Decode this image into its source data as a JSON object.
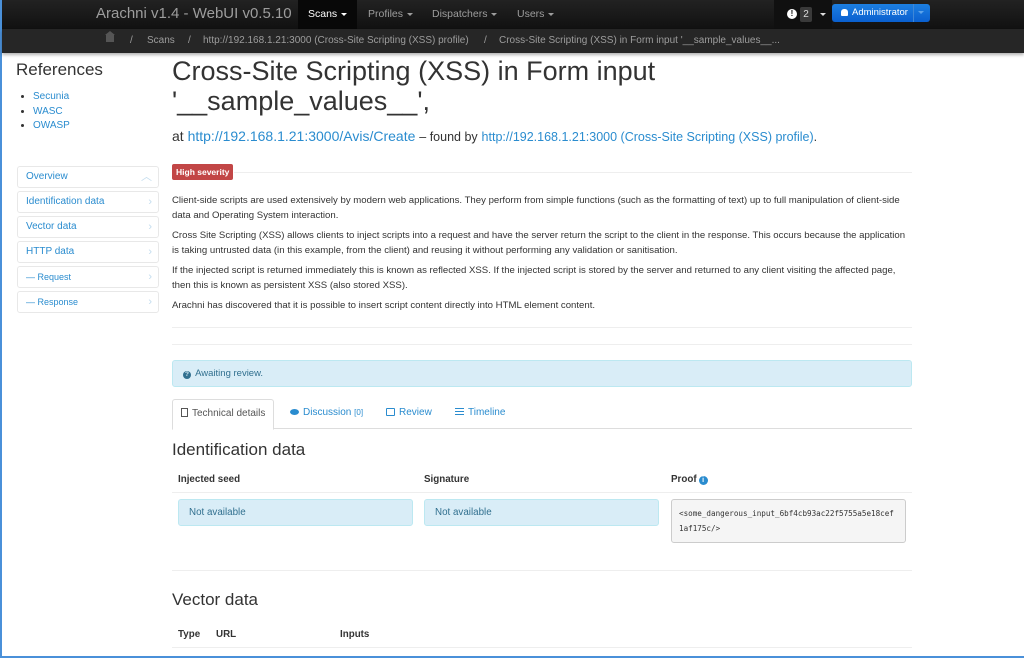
{
  "navbar": {
    "brand": "Arachni v1.4 - WebUI v0.5.10",
    "items": [
      {
        "label": "Scans",
        "active": true
      },
      {
        "label": "Profiles",
        "active": false
      },
      {
        "label": "Dispatchers",
        "active": false
      },
      {
        "label": "Users",
        "active": false
      }
    ],
    "notifications": {
      "icon": "exclamation-circle-icon",
      "count": "2"
    },
    "user": {
      "icon": "user-icon",
      "label": "Administrator"
    }
  },
  "breadcrumb": {
    "home_icon": "home-icon",
    "items": [
      "Scans",
      "http://192.168.1.21:3000 (Cross-Site Scripting (XSS) profile)",
      "Cross-Site Scripting (XSS) in Form input '__sample_values__..."
    ],
    "separator": "/"
  },
  "sidebar": {
    "references_title": "References",
    "references": [
      "Secunia",
      "WASC",
      "OWASP"
    ],
    "nav": [
      {
        "label": "Overview",
        "icon": "chevron-up-icon"
      },
      {
        "label": "Identification data",
        "icon": "chevron-right-icon"
      },
      {
        "label": "Vector data",
        "icon": "chevron-right-icon"
      },
      {
        "label": "HTTP data",
        "icon": "chevron-right-icon"
      },
      {
        "label": "— Request",
        "icon": "chevron-right-icon"
      },
      {
        "label": "— Response",
        "icon": "chevron-right-icon"
      }
    ]
  },
  "issue": {
    "title_line1": "Cross-Site Scripting (XSS) in Form input",
    "title_line2": "'__sample_values__',",
    "at_label": "at",
    "url": "http://192.168.1.21:3000/Avis/Create",
    "found_by_label": "– found by",
    "profile": "http://192.168.1.21:3000 (Cross-Site Scripting (XSS) profile)",
    "period": ".",
    "severity": "High severity",
    "severity_color": "#c24646",
    "description": [
      "Client-side scripts are used extensively by modern web applications. They perform from simple functions (such as the formatting of text) up to full manipulation of client-side data and Operating System interaction.",
      "Cross Site Scripting (XSS) allows clients to inject scripts into a request and have the server return the script to the client in the response. This occurs because the application is taking untrusted data (in this example, from the client) and reusing it without performing any validation or sanitisation.",
      "If the injected script is returned immediately this is known as reflected XSS. If the injected script is stored by the server and returned to any client visiting the affected page, then this is known as persistent XSS (also stored XSS).",
      "Arachni has discovered that it is possible to insert script content directly into HTML element content."
    ],
    "review_status": "Awaiting review."
  },
  "tabs": [
    {
      "label": "Technical details",
      "icon": "file-icon",
      "active": true
    },
    {
      "label": "Discussion",
      "count": "[0]",
      "icon": "comments-icon",
      "active": false
    },
    {
      "label": "Review",
      "icon": "edit-icon",
      "active": false
    },
    {
      "label": "Timeline",
      "icon": "list-icon",
      "active": false
    }
  ],
  "identification": {
    "title": "Identification data",
    "headers": [
      "Injected seed",
      "Signature",
      "Proof"
    ],
    "injected_seed": "Not available",
    "signature": "Not available",
    "proof": "<some_dangerous_input_6bf4cb93ac22f5755a5e18cef1af175c/>"
  },
  "vector": {
    "title": "Vector data",
    "headers": [
      "Type",
      "URL",
      "Inputs"
    ]
  },
  "colors": {
    "link": "#2a8ccf",
    "info_bg": "#d9edf7",
    "info_text": "#31708f",
    "admin_button": "#0a5fcf"
  }
}
